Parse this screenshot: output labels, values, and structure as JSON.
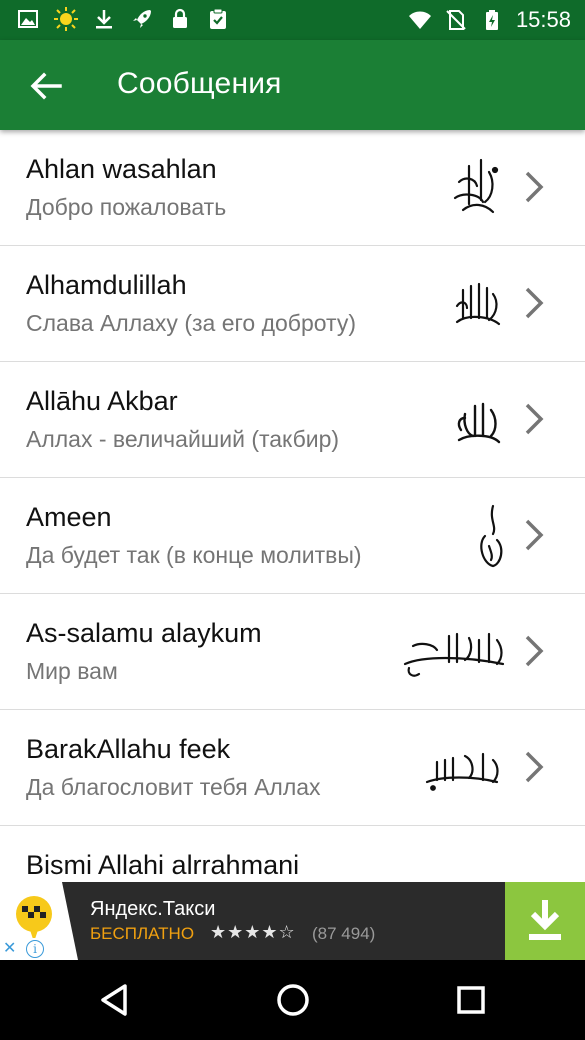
{
  "status_bar": {
    "time": "15:58",
    "left_icons": [
      "image-icon",
      "weather-icon",
      "download-icon",
      "rocket-icon",
      "lock-icon",
      "clipboard-check-icon"
    ],
    "right_icons": [
      "wifi-icon",
      "no-sim-icon",
      "battery-charging-icon"
    ]
  },
  "app_bar": {
    "title": "Сообщения",
    "back_icon": "arrow-back-icon",
    "color": "#1b7f35"
  },
  "list": {
    "items": [
      {
        "title": "Ahlan wasahlan",
        "subtitle": "Добро пожаловать",
        "calligraphy_icon": "ahlan-wasahlan-calligraphy-icon"
      },
      {
        "title": "Alhamdulillah",
        "subtitle": "Слава Аллаху (за его доброту)",
        "calligraphy_icon": "alhamdulillah-calligraphy-icon"
      },
      {
        "title": "Allāhu Akbar",
        "subtitle": "Аллах - величайший (такбир)",
        "calligraphy_icon": "allahu-akbar-calligraphy-icon"
      },
      {
        "title": "Ameen",
        "subtitle": "Да будет так (в конце молитвы)",
        "calligraphy_icon": "ameen-calligraphy-icon"
      },
      {
        "title": "As-salamu alaykum",
        "subtitle": "Мир вам",
        "calligraphy_icon": "as-salamu-alaykum-calligraphy-icon"
      },
      {
        "title": "BarakAllahu feek",
        "subtitle": "Да благословит тебя Аллах",
        "calligraphy_icon": "barakallahu-feek-calligraphy-icon"
      },
      {
        "title": "Bismi Allahi alrrahmani",
        "subtitle": "",
        "calligraphy_icon": ""
      }
    ]
  },
  "ad": {
    "app_name": "Яндекс.Такси",
    "price_label": "БЕСПЛАТНО",
    "stars": "★★★★☆",
    "rating": 4,
    "rating_count": "(87 494)",
    "download_color": "#8cc63f"
  },
  "nav_bar": {
    "icons": [
      "back-triangle-icon",
      "home-circle-icon",
      "recents-square-icon"
    ]
  }
}
